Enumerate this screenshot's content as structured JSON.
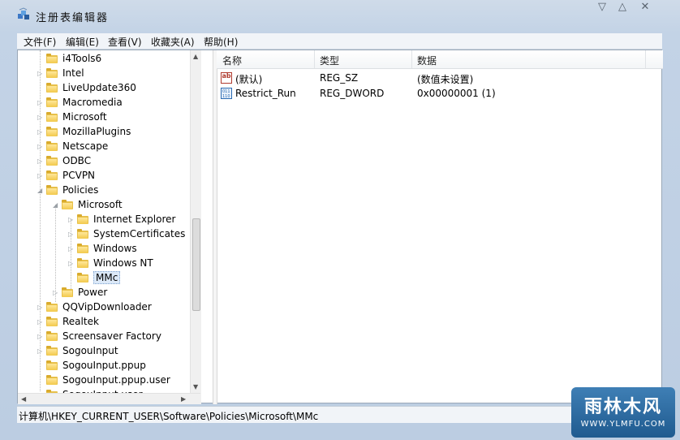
{
  "window": {
    "title": "注册表编辑器",
    "controls": {
      "minimize": "▽",
      "restore": "△",
      "close": "✕"
    }
  },
  "menu": {
    "items": [
      "文件(F)",
      "编辑(E)",
      "查看(V)",
      "收藏夹(A)",
      "帮助(H)"
    ]
  },
  "tree": {
    "items": [
      {
        "label": "i4Tools6",
        "level": 1,
        "expander": ""
      },
      {
        "label": "Intel",
        "level": 1,
        "expander": "▷"
      },
      {
        "label": "LiveUpdate360",
        "level": 1,
        "expander": ""
      },
      {
        "label": "Macromedia",
        "level": 1,
        "expander": "▷"
      },
      {
        "label": "Microsoft",
        "level": 1,
        "expander": "▷"
      },
      {
        "label": "MozillaPlugins",
        "level": 1,
        "expander": "▷"
      },
      {
        "label": "Netscape",
        "level": 1,
        "expander": "▷"
      },
      {
        "label": "ODBC",
        "level": 1,
        "expander": "▷"
      },
      {
        "label": "PCVPN",
        "level": 1,
        "expander": "▷"
      },
      {
        "label": "Policies",
        "level": 1,
        "expander": "◢"
      },
      {
        "label": "Microsoft",
        "level": 2,
        "expander": "◢"
      },
      {
        "label": "Internet Explorer",
        "level": 3,
        "expander": "▷"
      },
      {
        "label": "SystemCertificates",
        "level": 3,
        "expander": "▷"
      },
      {
        "label": "Windows",
        "level": 3,
        "expander": "▷"
      },
      {
        "label": "Windows NT",
        "level": 3,
        "expander": "▷"
      },
      {
        "label": "MMc",
        "level": 3,
        "expander": "",
        "selected": true
      },
      {
        "label": "Power",
        "level": 2,
        "expander": "▷"
      },
      {
        "label": "QQVipDownloader",
        "level": 1,
        "expander": "▷"
      },
      {
        "label": "Realtek",
        "level": 1,
        "expander": "▷"
      },
      {
        "label": "Screensaver Factory",
        "level": 1,
        "expander": "▷"
      },
      {
        "label": "SogouInput",
        "level": 1,
        "expander": "▷"
      },
      {
        "label": "SogouInput.ppup",
        "level": 1,
        "expander": ""
      },
      {
        "label": "SogouInput.ppup.user",
        "level": 1,
        "expander": ""
      },
      {
        "label": "SogouInput.user",
        "level": 1,
        "expander": ""
      }
    ]
  },
  "list": {
    "columns": [
      "名称",
      "类型",
      "数据"
    ],
    "rows": [
      {
        "icon": "string-value-icon",
        "icon_text": "ab",
        "name": "(默认)",
        "type": "REG_SZ",
        "data": "(数值未设置)"
      },
      {
        "icon": "binary-value-icon",
        "icon_text": "011\n110",
        "name": "Restrict_Run",
        "type": "REG_DWORD",
        "data": "0x00000001 (1)"
      }
    ]
  },
  "status": {
    "path": "计算机\\HKEY_CURRENT_USER\\Software\\Policies\\Microsoft\\MMc"
  },
  "watermark": {
    "main": "雨林木风",
    "sub": "WWW.YLMFU.COM"
  },
  "colors": {
    "folder": "#e7c04a",
    "selection": "#dce9f8",
    "window_frame": "#c3d3e6"
  }
}
